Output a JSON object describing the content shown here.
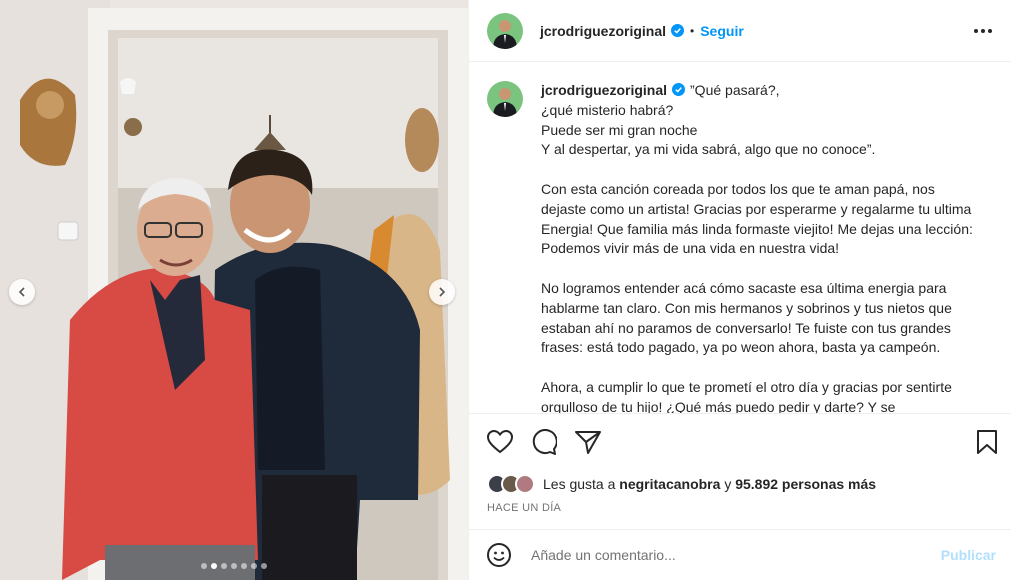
{
  "post": {
    "username": "jcrodriguezoriginal",
    "follow_label": "Seguir",
    "separator": "•",
    "caption": "”Qué pasará?,\n¿qué misterio habrá?\nPuede ser mi gran noche\nY al despertar, ya mi vida sabrá, algo que no conoce”.\n\nCon esta canción coreada por todos los que te aman papá, nos dejaste como un artista! Gracias por esperarme y regalarme tu ultima Energia! Que familia más linda formaste viejito! Me dejas una lección: Podemos vivir más de una vida en nuestra vida!\n\nNo logramos entender acá cómo sacaste esa última energia para hablarme tan claro. Con mis hermanos y sobrinos y tus nietos que estaban ahí no paramos de conversarlo! Te fuiste con tus grandes frases: está todo pagado, ya po weon ahora, basta ya campeón.\n\nAhora, a cumplir lo que te prometí el otro día y gracias por sentirte orgulloso de tu hijo! ¿Qué más puedo pedir y darte? Y se",
    "likes_prefix": "Les gusta a",
    "likes_user": "negritacanobra",
    "likes_conj": "y",
    "likes_count": "95.892 personas más",
    "time_ago": "HACE UN DÍA",
    "comment_placeholder": "Añade un comentario...",
    "publish_label": "Publicar"
  },
  "carousel": {
    "slide_count": 7,
    "active_index": 1
  },
  "colors": {
    "accent": "#0095f6",
    "publish_disabled": "#b2dffc",
    "verified": "#0095f6"
  },
  "icons": [
    "verified-badge-icon",
    "more-options-icon",
    "heart-icon",
    "comment-icon",
    "share-icon",
    "bookmark-icon",
    "emoji-icon",
    "chevron-left-icon",
    "chevron-right-icon"
  ]
}
